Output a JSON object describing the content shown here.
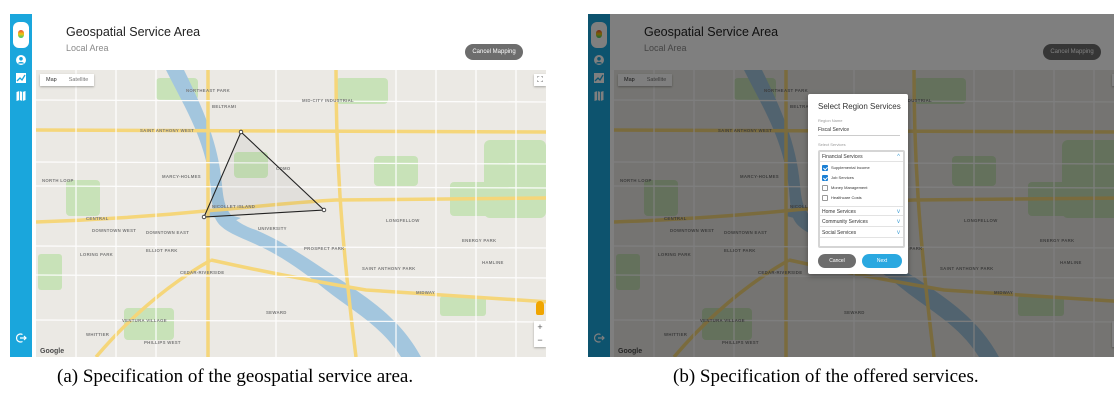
{
  "header": {
    "title": "Geospatial Service Area",
    "subtitle": "Local Area",
    "cancel_mapping": "Cancel Mapping"
  },
  "sidebar": {
    "icons": [
      "app-logo",
      "user-icon",
      "chart-icon",
      "map-icon",
      "logout-icon"
    ]
  },
  "map": {
    "type_toggle": [
      "Map",
      "Satellite"
    ],
    "fullscreen_glyph": "⛶",
    "zoom_in": "+",
    "zoom_out": "−",
    "brand": "Google",
    "labels": [
      "NORTHEAST PARK",
      "BELTRAMI",
      "SAINT ANTHONY WEST",
      "MID-CITY INDUSTRIAL",
      "NORTH LOOP",
      "MARCY-HOLMES",
      "COMO",
      "NICOLLET ISLAND",
      "CENTRAL",
      "DOWNTOWN WEST",
      "DOWNTOWN EAST",
      "ELLIOT PARK",
      "LORING PARK",
      "CEDAR-RIVERSIDE",
      "PROSPECT PARK",
      "UNIVERSITY",
      "SEWARD",
      "PHILLIPS WEST",
      "WHITTIER",
      "VENTURA VILLAGE",
      "MIDWAY",
      "SAINT ANTHONY PARK",
      "LONGFELLOW",
      "ENERGY PARK",
      "HAMLINE"
    ]
  },
  "modal": {
    "title": "Select Region Services",
    "region_name_label": "Region Name",
    "region_name_value": "Fiscal Service",
    "select_label": "Select Services",
    "sections": [
      {
        "label": "Financial Services",
        "expanded": true,
        "options": [
          {
            "label": "Supplemental Income",
            "checked": true
          },
          {
            "label": "Job Services",
            "checked": true
          },
          {
            "label": "Money Management",
            "checked": false
          },
          {
            "label": "Healthcare Costs",
            "checked": false
          }
        ]
      },
      {
        "label": "Home Services",
        "expanded": false
      },
      {
        "label": "Community Services",
        "expanded": false
      },
      {
        "label": "Social Services",
        "expanded": false
      }
    ],
    "cancel": "Cancel",
    "next": "Next"
  },
  "captions": {
    "a": "(a) Specification of the geospatial service area.",
    "b": "(b) Specification of the offered services."
  },
  "colors": {
    "sidebar": "#1aa6dc",
    "primary_button": "#2aa8e0",
    "secondary_button": "#6d6d6d",
    "water": "#a3c6de",
    "park": "#bfdfb0"
  }
}
